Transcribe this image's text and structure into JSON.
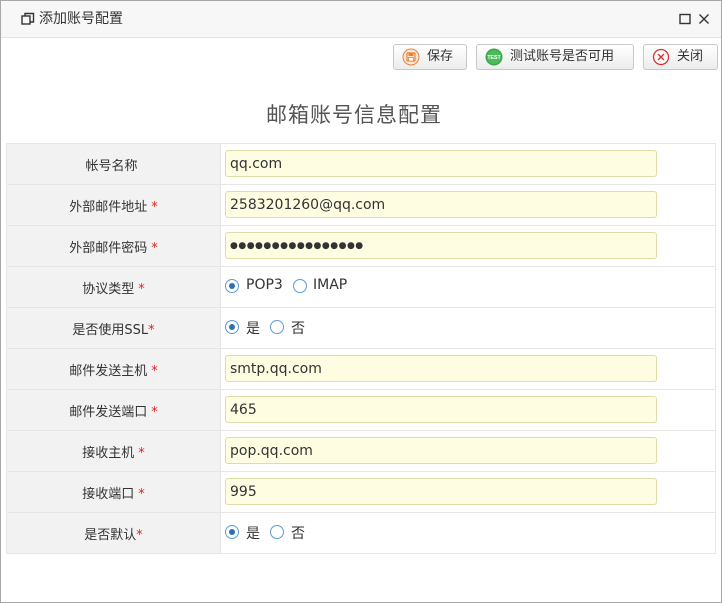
{
  "window": {
    "title": "添加账号配置"
  },
  "toolbar": {
    "save_label": "保存",
    "test_label": "测试账号是否可用",
    "test_icon_text": "TEST",
    "close_label": "关闭"
  },
  "form": {
    "title": "邮箱账号信息配置",
    "rows": [
      {
        "label": "帐号名称",
        "required": "",
        "value": "qq.com"
      },
      {
        "label": "外部邮件地址",
        "required": "*",
        "value": "2583201260@qq.com"
      },
      {
        "label": "外部邮件密码",
        "required": "*",
        "value": "●●●●●●●●●●●●●●●●"
      },
      {
        "label": "协议类型",
        "required": "*",
        "options": [
          "POP3",
          "IMAP"
        ],
        "selected": "POP3"
      },
      {
        "label": "是否使用SSL",
        "required": "*",
        "options": [
          "是",
          "否"
        ],
        "selected": "是"
      },
      {
        "label": "邮件发送主机",
        "required": "*",
        "value": "smtp.qq.com"
      },
      {
        "label": "邮件发送端口",
        "required": "*",
        "value": "465"
      },
      {
        "label": "接收主机",
        "required": "*",
        "value": "pop.qq.com"
      },
      {
        "label": "接收端口",
        "required": "*",
        "value": "995"
      },
      {
        "label": "是否默认",
        "required": "*",
        "options": [
          "是",
          "否"
        ],
        "selected": "是"
      }
    ]
  },
  "colors": {
    "input_bg": "#fffde1",
    "label_bg": "#f2f2f2",
    "required": "#e02020",
    "radio_accent": "#2f6fb3"
  }
}
